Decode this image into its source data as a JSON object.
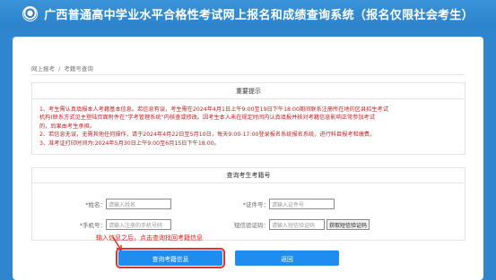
{
  "header": {
    "title": "广西普通高中学业水平合格性考试网上报名和成绩查询系统（报名仅限社会考生）"
  },
  "breadcrumb": {
    "items": [
      "网上报考",
      "考籍号查询"
    ],
    "separator": "/"
  },
  "notice": {
    "title": "重要提示",
    "lines": [
      "1、考生需认真填报本人考籍基本信息。若信息有误，考生需在2024年4月1日上午9:00至19日下午18:00期间联系注册所在地的区县招生考试",
      "机构(联系方式见主登陆页面附件在“学考管理系统”内核查或修改。因考生本人未在规定时间内认真填报并核对考籍信息影响正常参加考试",
      "的，后果由考生承担。",
      "2、若信息无误，无需其他任何操作，请于2024年4月22日至5月10日，每天9:00-17:00登录报名系统报名系统，进行科目报考和缴费。",
      "3、准考证打印时间为:2024年5月30日上午9:00至6月15日下午18:00。"
    ]
  },
  "query": {
    "title": "查询考生考籍号",
    "name_label": "*姓名：",
    "name_placeholder": "请输入姓名",
    "id_label": "*证件号：",
    "id_placeholder": "请输入证件号",
    "phone_label": "*手机号：",
    "phone_placeholder": "请输入注册的手机号码",
    "sms_label": "短信验证码：",
    "sms_placeholder": "请输入短信验证码",
    "sms_button": "获取短信验证码"
  },
  "hint": "输入信息之后，点击查询找回考籍信息",
  "buttons": {
    "query": "查询考籍信息",
    "back": "返回"
  },
  "colors": {
    "header_bg": "#2f86ce",
    "notice_text": "#c1232a",
    "button_bg": "#1f8cf0",
    "highlight": "#e0322a"
  }
}
